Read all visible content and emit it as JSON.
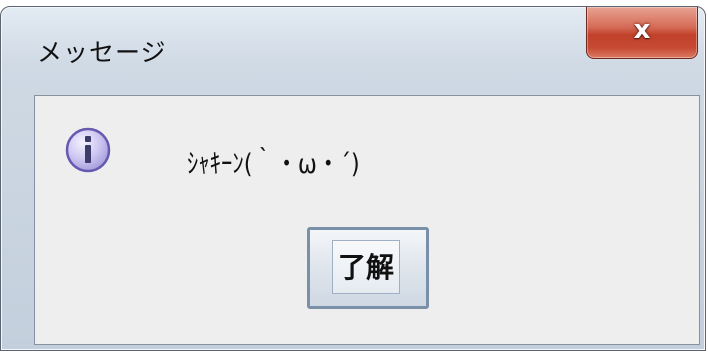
{
  "window": {
    "title": "メッセージ",
    "close_label": "x",
    "close_icon": "close-icon"
  },
  "dialog": {
    "icon": "information-icon",
    "icon_glyph": "i",
    "message": "ｼｬｷｰﾝ(｀・ω・´)",
    "ok_label": "了解"
  },
  "colors": {
    "close_button": "#c9503a",
    "info_icon_fill": "#c9c3ef",
    "info_icon_border": "#6659b0"
  }
}
